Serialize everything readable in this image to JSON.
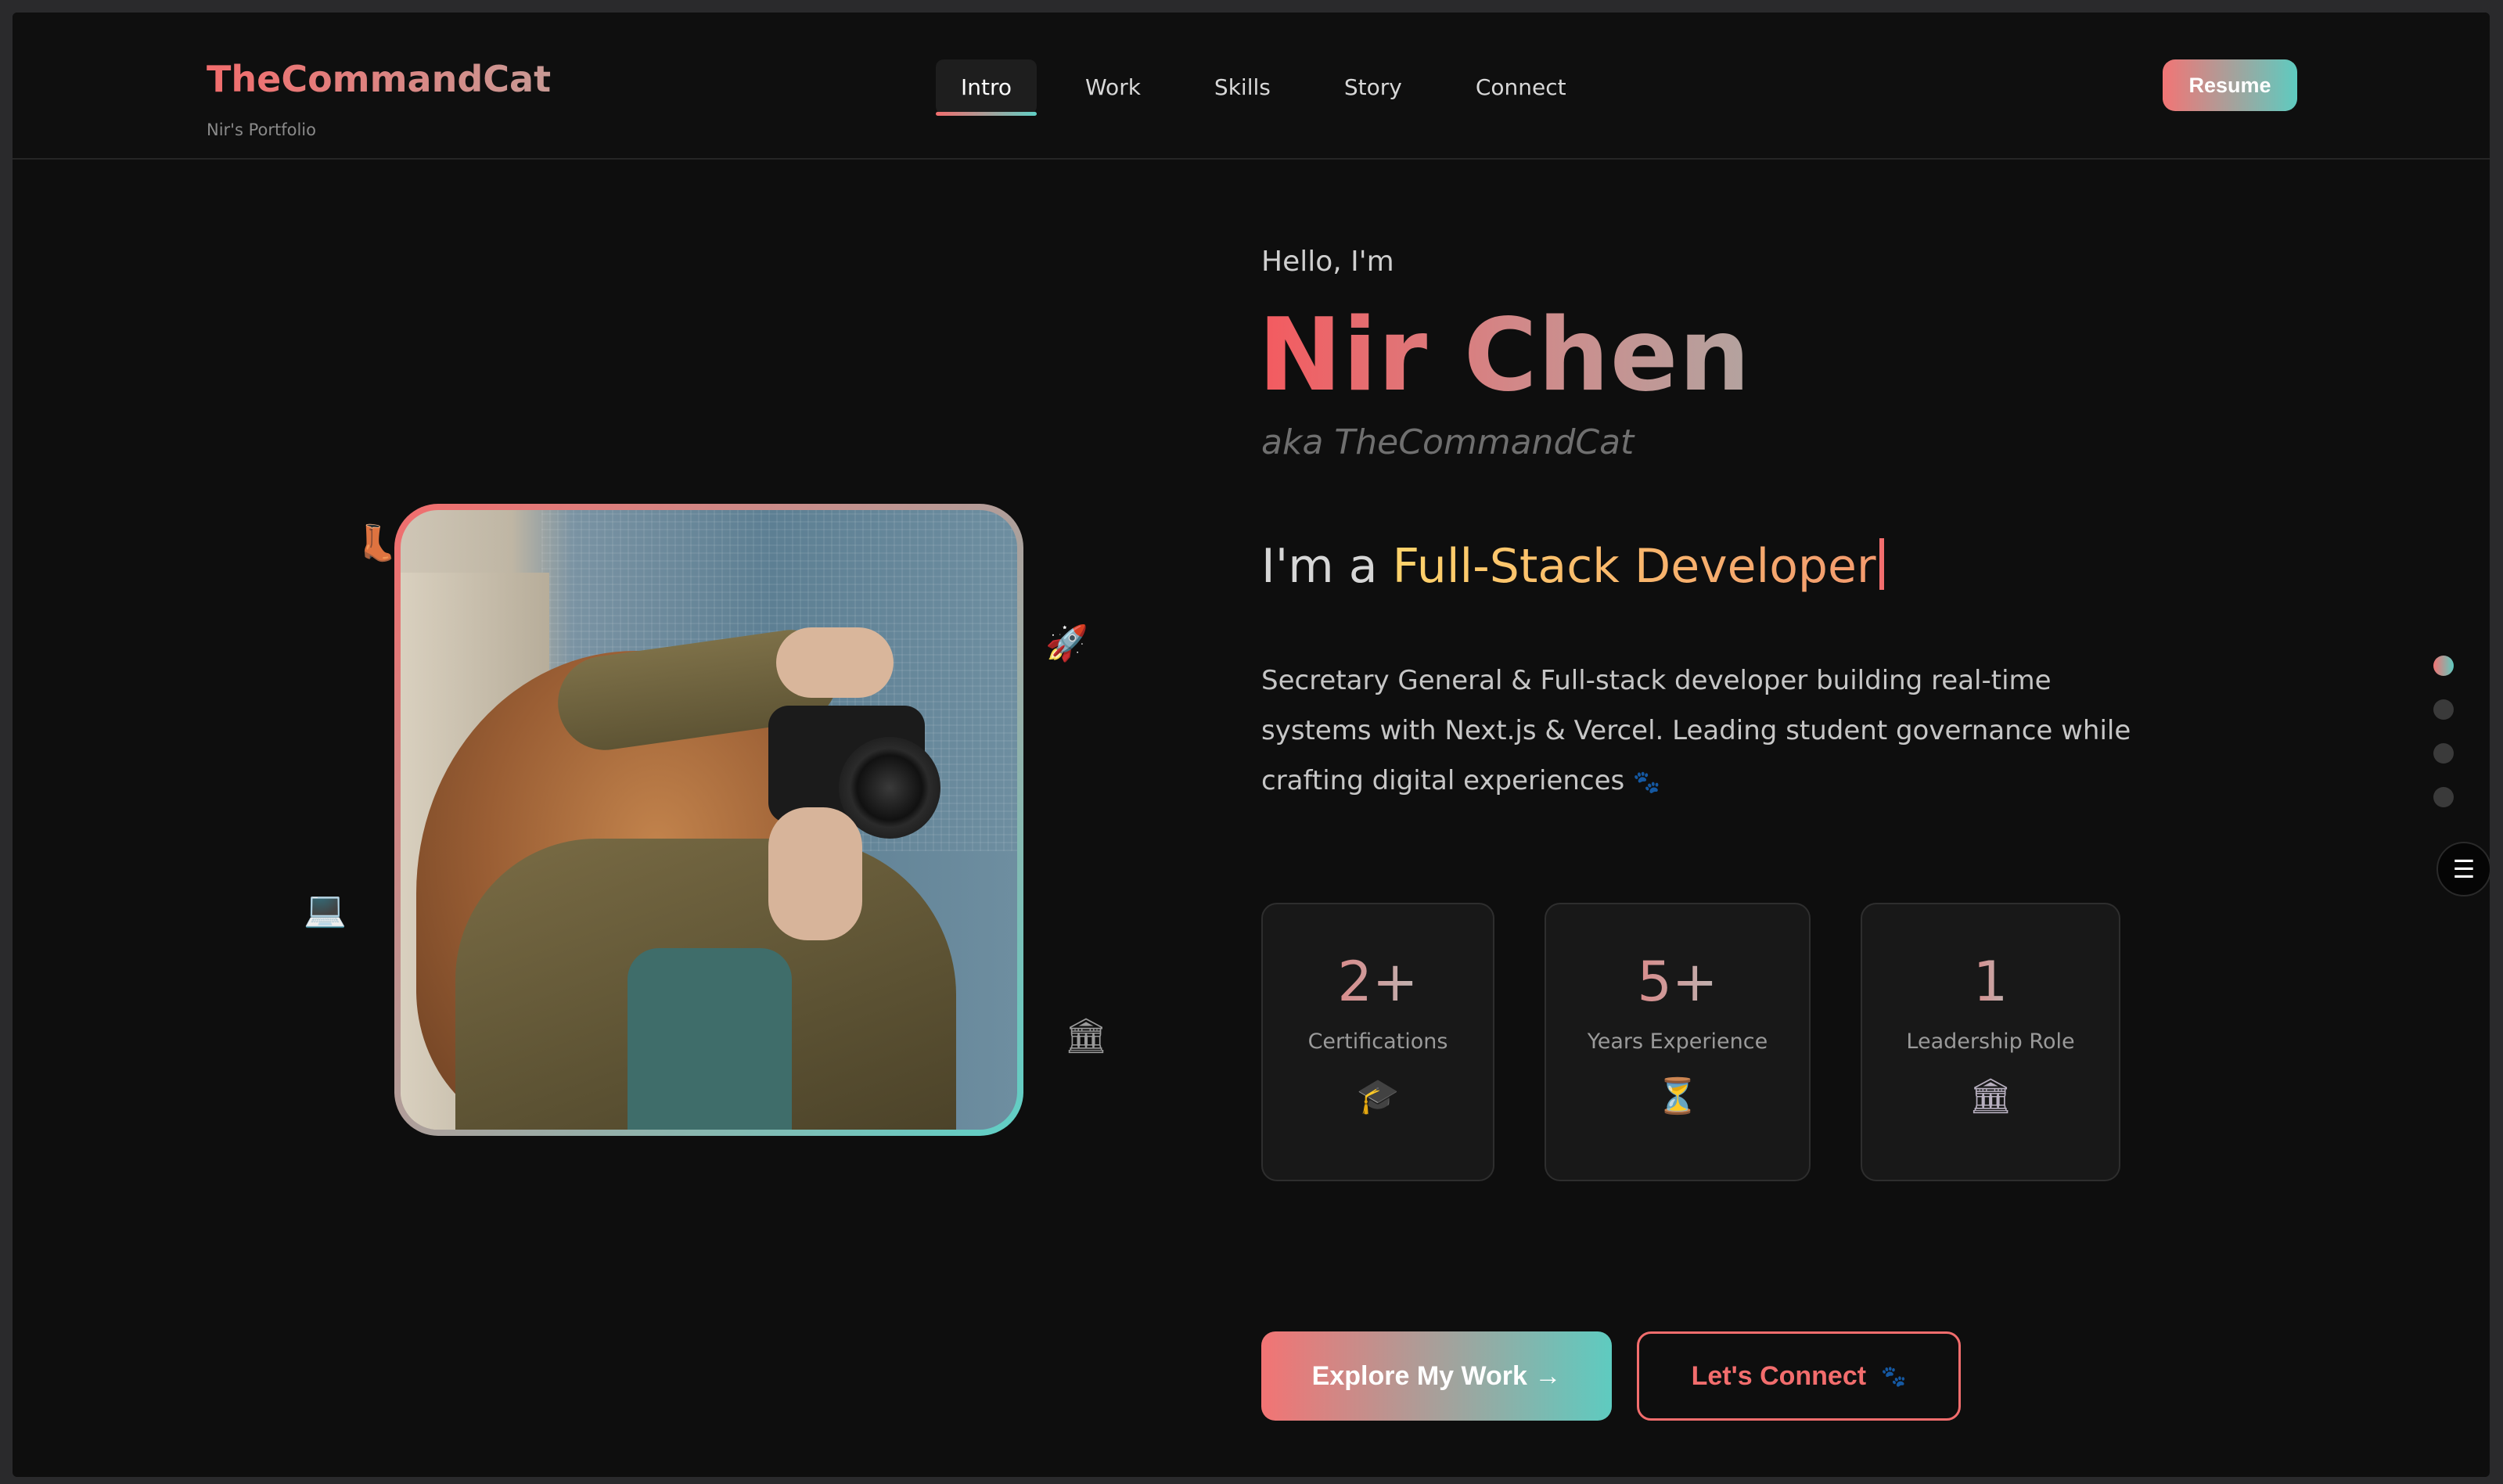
{
  "header": {
    "brand": "TheCommandCat",
    "brand_sub": "Nir's Portfolio",
    "nav": [
      "Intro",
      "Work",
      "Skills",
      "Story",
      "Connect"
    ],
    "active_nav": "Intro",
    "resume_label": "Resume"
  },
  "hero": {
    "hello": "Hello, I'm",
    "name": "Nir Chen",
    "aka": "aka TheCommandCat",
    "role_prefix": "I'm a ",
    "role_highlight": "Full-Stack Developer",
    "description": "Secretary General & Full-stack developer building real-time systems with Next.js & Vercel. Leading student governance while crafting digital experiences",
    "description_icon": "🐾"
  },
  "floating_icons": [
    "👢",
    "🚀",
    "💻",
    "🏛"
  ],
  "stats": [
    {
      "value": "2+",
      "label": "Certifications",
      "icon": "🎓"
    },
    {
      "value": "5+",
      "label": "Years Experience",
      "icon": "⏳"
    },
    {
      "value": "1",
      "label": "Leadership Role",
      "icon": "🏛"
    }
  ],
  "cta": {
    "primary": "Explore My Work →",
    "secondary": "Let's Connect",
    "secondary_icon": "🐾"
  },
  "side_nav": {
    "count": 5,
    "active_index": 0
  },
  "colors": {
    "accent_red": "#f26d6d",
    "accent_teal": "#5ecbc0",
    "highlight": "#ffd36b",
    "bg": "#0e0e0e"
  }
}
